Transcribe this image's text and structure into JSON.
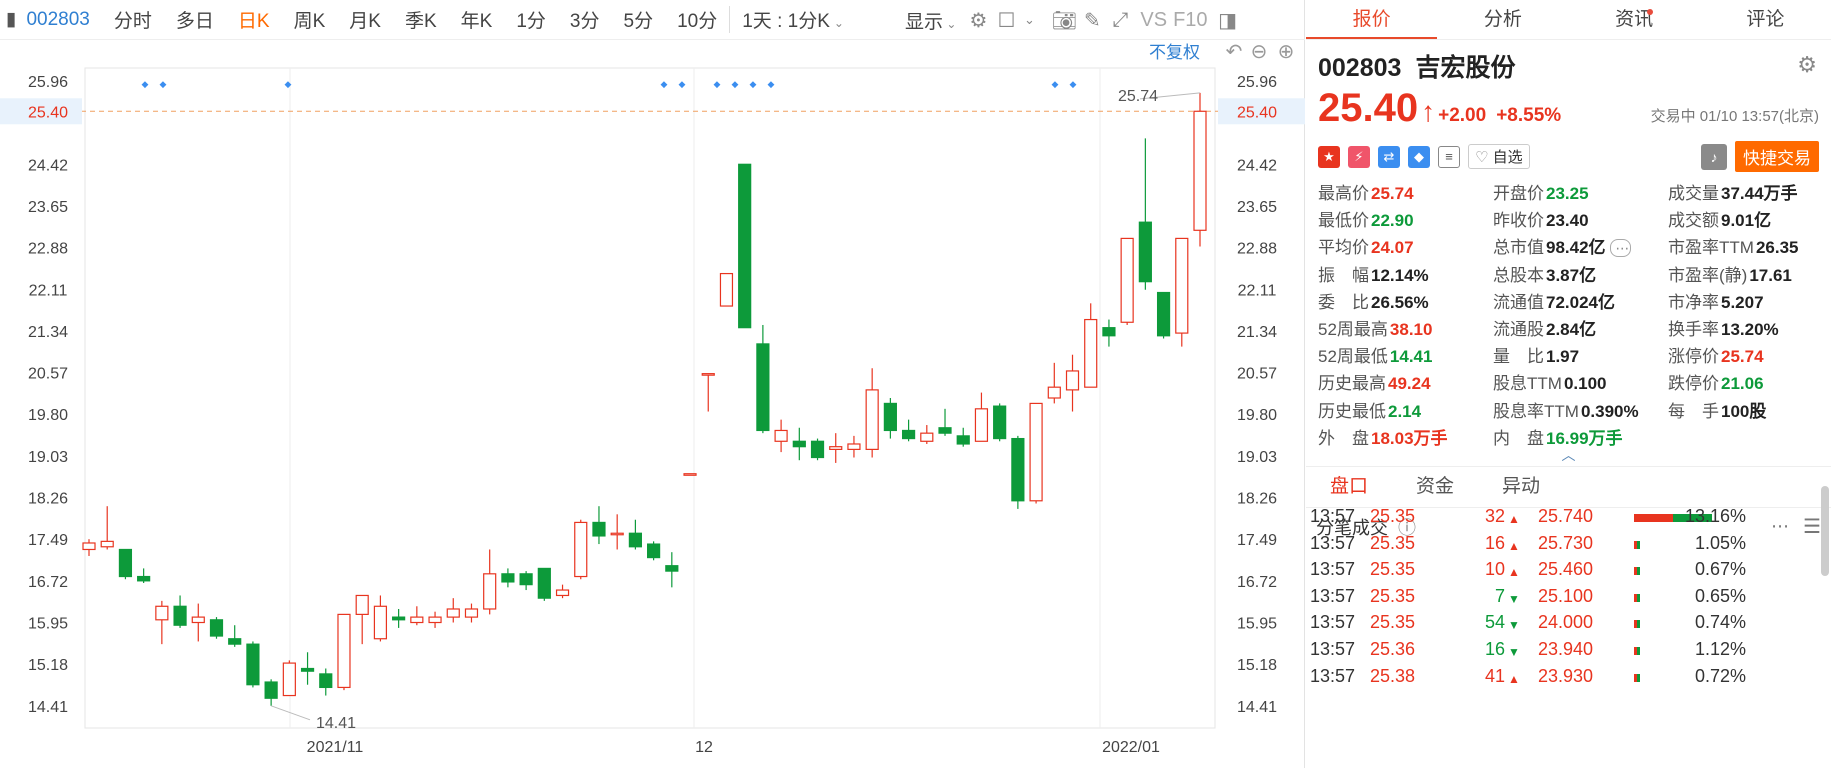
{
  "toolbar": {
    "code": "002803",
    "items": [
      "分时",
      "多日",
      "日K",
      "周K",
      "月K",
      "季K",
      "年K",
      "1分",
      "3分",
      "5分",
      "10分",
      "1天 : 1分K"
    ],
    "active_index": 2,
    "display_label": "显示",
    "vs_label": "VS",
    "f10_label": "F10",
    "fuquan_label": "不复权"
  },
  "chart": {
    "y_ticks": [
      "25.96",
      "25.40",
      "24.42",
      "23.65",
      "22.88",
      "22.11",
      "21.34",
      "20.57",
      "19.80",
      "19.03",
      "18.26",
      "17.49",
      "16.72",
      "15.95",
      "15.18",
      "14.41"
    ],
    "current_price_label": "25.40",
    "high_label": "25.74",
    "low_label": "14.41",
    "x_labels": [
      "2021/11",
      "12",
      "2022/01"
    ]
  },
  "chart_data": {
    "type": "candlestick",
    "ylim": [
      14.0,
      26.2
    ],
    "current_price": 25.4,
    "high_annotation": 25.74,
    "low_annotation": 14.41,
    "candles": [
      {
        "o": 17.3,
        "c": 17.42,
        "h": 17.49,
        "l": 17.18
      },
      {
        "o": 17.35,
        "c": 17.45,
        "h": 18.1,
        "l": 17.3
      },
      {
        "o": 17.3,
        "c": 16.8,
        "h": 17.3,
        "l": 16.75
      },
      {
        "o": 16.8,
        "c": 16.72,
        "h": 16.95,
        "l": 16.68
      },
      {
        "o": 16.0,
        "c": 16.25,
        "h": 16.35,
        "l": 15.55
      },
      {
        "o": 16.25,
        "c": 15.9,
        "h": 16.45,
        "l": 15.85
      },
      {
        "o": 15.95,
        "c": 16.05,
        "h": 16.3,
        "l": 15.6
      },
      {
        "o": 16.0,
        "c": 15.7,
        "h": 16.05,
        "l": 15.65
      },
      {
        "o": 15.65,
        "c": 15.55,
        "h": 15.9,
        "l": 15.5
      },
      {
        "o": 15.55,
        "c": 14.8,
        "h": 15.6,
        "l": 14.75
      },
      {
        "o": 14.85,
        "c": 14.55,
        "h": 14.9,
        "l": 14.41
      },
      {
        "o": 14.6,
        "c": 15.2,
        "h": 15.25,
        "l": 14.6
      },
      {
        "o": 15.1,
        "c": 15.05,
        "h": 15.4,
        "l": 14.8
      },
      {
        "o": 15.0,
        "c": 14.75,
        "h": 15.1,
        "l": 14.6
      },
      {
        "o": 14.75,
        "c": 16.1,
        "h": 16.1,
        "l": 14.7
      },
      {
        "o": 16.1,
        "c": 16.45,
        "h": 16.45,
        "l": 15.55
      },
      {
        "o": 15.65,
        "c": 16.25,
        "h": 16.45,
        "l": 15.6
      },
      {
        "o": 16.05,
        "c": 16.0,
        "h": 16.2,
        "l": 15.85
      },
      {
        "o": 15.95,
        "c": 16.05,
        "h": 16.25,
        "l": 15.9
      },
      {
        "o": 15.95,
        "c": 16.05,
        "h": 16.15,
        "l": 15.85
      },
      {
        "o": 16.05,
        "c": 16.2,
        "h": 16.4,
        "l": 15.95
      },
      {
        "o": 16.05,
        "c": 16.2,
        "h": 16.3,
        "l": 15.95
      },
      {
        "o": 16.2,
        "c": 16.85,
        "h": 17.3,
        "l": 16.1
      },
      {
        "o": 16.85,
        "c": 16.7,
        "h": 16.95,
        "l": 16.6
      },
      {
        "o": 16.85,
        "c": 16.65,
        "h": 16.9,
        "l": 16.55
      },
      {
        "o": 16.95,
        "c": 16.4,
        "h": 16.95,
        "l": 16.35
      },
      {
        "o": 16.45,
        "c": 16.55,
        "h": 16.65,
        "l": 16.4
      },
      {
        "o": 16.8,
        "c": 17.8,
        "h": 17.85,
        "l": 16.75
      },
      {
        "o": 17.8,
        "c": 17.55,
        "h": 18.1,
        "l": 17.4
      },
      {
        "o": 17.6,
        "c": 17.6,
        "h": 17.95,
        "l": 17.3
      },
      {
        "o": 17.6,
        "c": 17.35,
        "h": 17.85,
        "l": 17.3
      },
      {
        "o": 17.4,
        "c": 17.15,
        "h": 17.45,
        "l": 17.1
      },
      {
        "o": 17.0,
        "c": 16.9,
        "h": 17.25,
        "l": 16.6
      },
      {
        "o": 18.7,
        "c": 18.7,
        "h": 18.7,
        "l": 18.7
      },
      {
        "o": 20.55,
        "c": 20.55,
        "h": 20.55,
        "l": 19.85
      },
      {
        "o": 21.8,
        "c": 22.4,
        "h": 22.4,
        "l": 21.8
      },
      {
        "o": 24.42,
        "c": 21.4,
        "h": 24.42,
        "l": 21.4
      },
      {
        "o": 21.1,
        "c": 19.5,
        "h": 21.45,
        "l": 19.45
      },
      {
        "o": 19.3,
        "c": 19.5,
        "h": 19.7,
        "l": 19.1
      },
      {
        "o": 19.3,
        "c": 19.2,
        "h": 19.55,
        "l": 18.95
      },
      {
        "o": 19.3,
        "c": 19.0,
        "h": 19.35,
        "l": 18.95
      },
      {
        "o": 19.15,
        "c": 19.2,
        "h": 19.45,
        "l": 18.9
      },
      {
        "o": 19.15,
        "c": 19.25,
        "h": 19.4,
        "l": 19.0
      },
      {
        "o": 19.15,
        "c": 20.25,
        "h": 20.65,
        "l": 19.0
      },
      {
        "o": 20.0,
        "c": 19.5,
        "h": 20.1,
        "l": 19.35
      },
      {
        "o": 19.5,
        "c": 19.35,
        "h": 19.7,
        "l": 19.3
      },
      {
        "o": 19.3,
        "c": 19.45,
        "h": 19.6,
        "l": 19.25
      },
      {
        "o": 19.55,
        "c": 19.45,
        "h": 19.9,
        "l": 19.4
      },
      {
        "o": 19.4,
        "c": 19.25,
        "h": 19.55,
        "l": 19.2
      },
      {
        "o": 19.3,
        "c": 19.9,
        "h": 20.2,
        "l": 19.3
      },
      {
        "o": 19.95,
        "c": 19.35,
        "h": 20.0,
        "l": 19.3
      },
      {
        "o": 19.35,
        "c": 18.2,
        "h": 19.4,
        "l": 18.05
      },
      {
        "o": 18.2,
        "c": 20.0,
        "h": 20.0,
        "l": 18.15
      },
      {
        "o": 20.1,
        "c": 20.3,
        "h": 20.75,
        "l": 20.0
      },
      {
        "o": 20.25,
        "c": 20.6,
        "h": 20.9,
        "l": 19.85
      },
      {
        "o": 20.3,
        "c": 21.55,
        "h": 21.85,
        "l": 20.3
      },
      {
        "o": 21.4,
        "c": 21.25,
        "h": 21.55,
        "l": 21.05
      },
      {
        "o": 21.5,
        "c": 23.05,
        "h": 23.05,
        "l": 21.45
      },
      {
        "o": 23.35,
        "c": 22.25,
        "h": 24.9,
        "l": 22.1
      },
      {
        "o": 22.05,
        "c": 21.25,
        "h": 22.05,
        "l": 21.2
      },
      {
        "o": 21.3,
        "c": 23.05,
        "h": 23.05,
        "l": 21.05
      },
      {
        "o": 23.2,
        "c": 25.4,
        "h": 25.74,
        "l": 22.9
      }
    ]
  },
  "stock": {
    "code": "002803",
    "name": "吉宏股份",
    "price": "25.40",
    "change": "+2.00",
    "change_pct": "+8.55%",
    "status": "交易中 01/10 13:57(北京)",
    "fav_label": "自选",
    "trade_label": "快捷交易"
  },
  "right_tabs": [
    "报价",
    "分析",
    "资讯",
    "评论"
  ],
  "stats": [
    {
      "k": "最高价",
      "v": "25.74",
      "c": "red"
    },
    {
      "k": "开盘价",
      "v": "23.25",
      "c": "green"
    },
    {
      "k": "成交量",
      "v": "37.44万手",
      "c": "dark"
    },
    {
      "k": "最低价",
      "v": "22.90",
      "c": "green"
    },
    {
      "k": "昨收价",
      "v": "23.40",
      "c": "dark"
    },
    {
      "k": "成交额",
      "v": "9.01亿",
      "c": "dark"
    },
    {
      "k": "平均价",
      "v": "24.07",
      "c": "red"
    },
    {
      "k": "总市值",
      "v": "98.42亿",
      "c": "dark"
    },
    {
      "k": "市盈率TTM",
      "v": "26.35",
      "c": "dark"
    },
    {
      "k": "振　幅",
      "v": "12.14%",
      "c": "dark"
    },
    {
      "k": "总股本",
      "v": "3.87亿",
      "c": "dark"
    },
    {
      "k": "市盈率(静)",
      "v": "17.61",
      "c": "dark"
    },
    {
      "k": "委　比",
      "v": "26.56%",
      "c": "dark"
    },
    {
      "k": "流通值",
      "v": "72.024亿",
      "c": "dark"
    },
    {
      "k": "市净率",
      "v": "5.207",
      "c": "dark"
    },
    {
      "k": "52周最高",
      "v": "38.10",
      "c": "red"
    },
    {
      "k": "流通股",
      "v": "2.84亿",
      "c": "dark"
    },
    {
      "k": "换手率",
      "v": "13.20%",
      "c": "dark"
    },
    {
      "k": "52周最低",
      "v": "14.41",
      "c": "green"
    },
    {
      "k": "量　比",
      "v": "1.97",
      "c": "dark"
    },
    {
      "k": "涨停价",
      "v": "25.74",
      "c": "red"
    },
    {
      "k": "历史最高",
      "v": "49.24",
      "c": "red"
    },
    {
      "k": "股息TTM",
      "v": "0.100",
      "c": "dark"
    },
    {
      "k": "跌停价",
      "v": "21.06",
      "c": "green"
    },
    {
      "k": "历史最低",
      "v": "2.14",
      "c": "green"
    },
    {
      "k": "股息率TTM",
      "v": "0.390%",
      "c": "dark"
    },
    {
      "k": "每　手",
      "v": "100股",
      "c": "dark"
    },
    {
      "k": "外　盘",
      "v": "18.03万手",
      "c": "red"
    },
    {
      "k": "内　盘",
      "v": "16.99万手",
      "c": "green"
    },
    {
      "k": "",
      "v": "",
      "c": "dark"
    }
  ],
  "sub_tabs": [
    "盘口",
    "资金",
    "异动"
  ],
  "ticks_title": "分笔成交",
  "ticks": [
    {
      "time": "13:57",
      "price": "25.35",
      "vol": "32",
      "dir": "up",
      "p2": "25.740",
      "pct": "13.16%"
    },
    {
      "time": "13:57",
      "price": "25.35",
      "vol": "16",
      "dir": "up",
      "p2": "25.730",
      "pct": "1.05%"
    },
    {
      "time": "13:57",
      "price": "25.35",
      "vol": "10",
      "dir": "up",
      "p2": "25.460",
      "pct": "0.67%"
    },
    {
      "time": "13:57",
      "price": "25.35",
      "vol": "7",
      "dir": "down",
      "p2": "25.100",
      "pct": "0.65%"
    },
    {
      "time": "13:57",
      "price": "25.35",
      "vol": "54",
      "dir": "down",
      "p2": "24.000",
      "pct": "0.74%"
    },
    {
      "time": "13:57",
      "price": "25.36",
      "vol": "16",
      "dir": "down",
      "p2": "23.940",
      "pct": "1.12%"
    },
    {
      "time": "13:57",
      "price": "25.38",
      "vol": "41",
      "dir": "up",
      "p2": "23.930",
      "pct": "0.72%"
    }
  ],
  "colors": {
    "up": "#e8341f",
    "down": "#0d9a3a",
    "accent": "#ff6a00",
    "link": "#2f7fd1"
  }
}
